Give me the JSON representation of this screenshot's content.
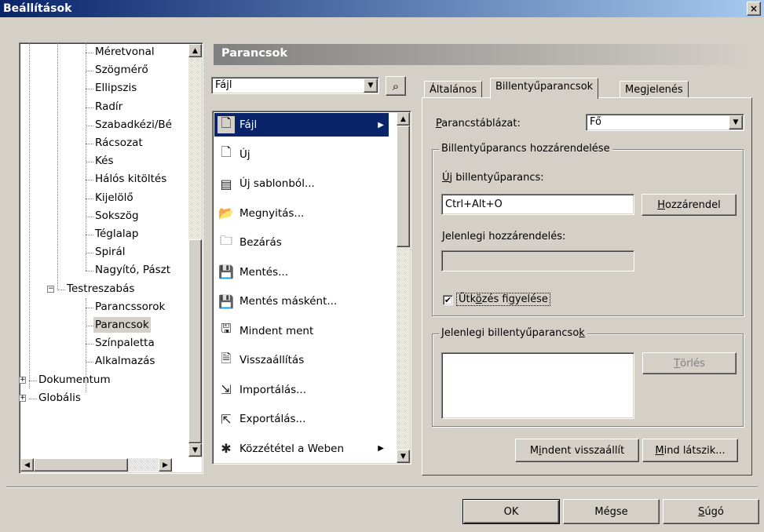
{
  "window": {
    "title": "Beállítások",
    "close_glyph": "×"
  },
  "tree": {
    "items": [
      {
        "label": "Méretvonal",
        "level": 3
      },
      {
        "label": "Szögmérő",
        "level": 3
      },
      {
        "label": "Ellipszis",
        "level": 3
      },
      {
        "label": "Radír",
        "level": 3
      },
      {
        "label": "Szabadkézi/Bé",
        "level": 3
      },
      {
        "label": "Rácsozat",
        "level": 3
      },
      {
        "label": "Kés",
        "level": 3
      },
      {
        "label": "Hálós kitöltés",
        "level": 3
      },
      {
        "label": "Kijelölő",
        "level": 3
      },
      {
        "label": "Sokszög",
        "level": 3
      },
      {
        "label": "Téglalap",
        "level": 3
      },
      {
        "label": "Spirál",
        "level": 3
      },
      {
        "label": "Nagyító, Pászt",
        "level": 3
      },
      {
        "label": "Testreszabás",
        "level": 2,
        "expander": "−"
      },
      {
        "label": "Parancssorok",
        "level": 3
      },
      {
        "label": "Parancsok",
        "level": 3,
        "selected": true
      },
      {
        "label": "Színpaletta",
        "level": 3
      },
      {
        "label": "Alkalmazás",
        "level": 3
      },
      {
        "label": "Dokumentum",
        "level": 1,
        "expander": "+"
      },
      {
        "label": "Globális",
        "level": 1,
        "expander": "+"
      }
    ]
  },
  "panel": {
    "header": "Parancsok",
    "category_combo": {
      "value": "Fájl"
    },
    "find_icon": "binoculars-icon",
    "commands": [
      {
        "label": "Fájl",
        "icon": "🗋",
        "submenu": true,
        "selected": true
      },
      {
        "label": "Új",
        "icon": "🗋"
      },
      {
        "label": "Új sablonból...",
        "icon": "▤"
      },
      {
        "label": "Megnyitás...",
        "icon": "📂"
      },
      {
        "label": "Bezárás",
        "icon": "🗀"
      },
      {
        "label": "Mentés...",
        "icon": "💾"
      },
      {
        "label": "Mentés másként...",
        "icon": "💾"
      },
      {
        "label": "Mindent ment",
        "icon": "🖫"
      },
      {
        "label": "Visszaállítás",
        "icon": "🗎"
      },
      {
        "label": "Importálás...",
        "icon": "⇲"
      },
      {
        "label": "Exportálás...",
        "icon": "⇱"
      },
      {
        "label": "Közzététel a Weben",
        "icon": "✱",
        "submenu": true
      }
    ]
  },
  "tabs": [
    {
      "label": "Általános",
      "active": false
    },
    {
      "label": "Billentyűparancsok",
      "active": true
    },
    {
      "label": "Megjelenés",
      "active": false
    }
  ],
  "shortcuts": {
    "table_label_u": "P",
    "table_label_rest": "arancstáblázat:",
    "table_value": "Fő",
    "assign_group_title": "Billentyűparancs hozzárendelése",
    "new_label_u": "Ú",
    "new_label_rest": "j billentyűparancs:",
    "new_value": "Ctrl+Alt+O",
    "assign_button_u": "H",
    "assign_button_rest": "ozzárendel",
    "current_assign_label": "Jelenlegi hozzárendelés:",
    "current_assign_value": "",
    "conflict_check_pre": "Ütk",
    "conflict_check_u1": "ö",
    "conflict_check_mid": "zés fi",
    "conflict_check_u2": "g",
    "conflict_check_post": "yelése",
    "conflict_checked_glyph": "✔",
    "current_group_title_pre": "Jelenlegi billentyűparancso",
    "current_group_title_u": "k",
    "delete_button_u": "T",
    "delete_button_rest": "örlés",
    "reset_all_pre": "M",
    "reset_all_u": "i",
    "reset_all_rest": "ndent visszaállít",
    "show_all_u": "M",
    "show_all_rest": "ind látszik..."
  },
  "footer": {
    "ok": "OK",
    "cancel": "Mégse",
    "help_u": "S",
    "help_rest": "úgó"
  }
}
